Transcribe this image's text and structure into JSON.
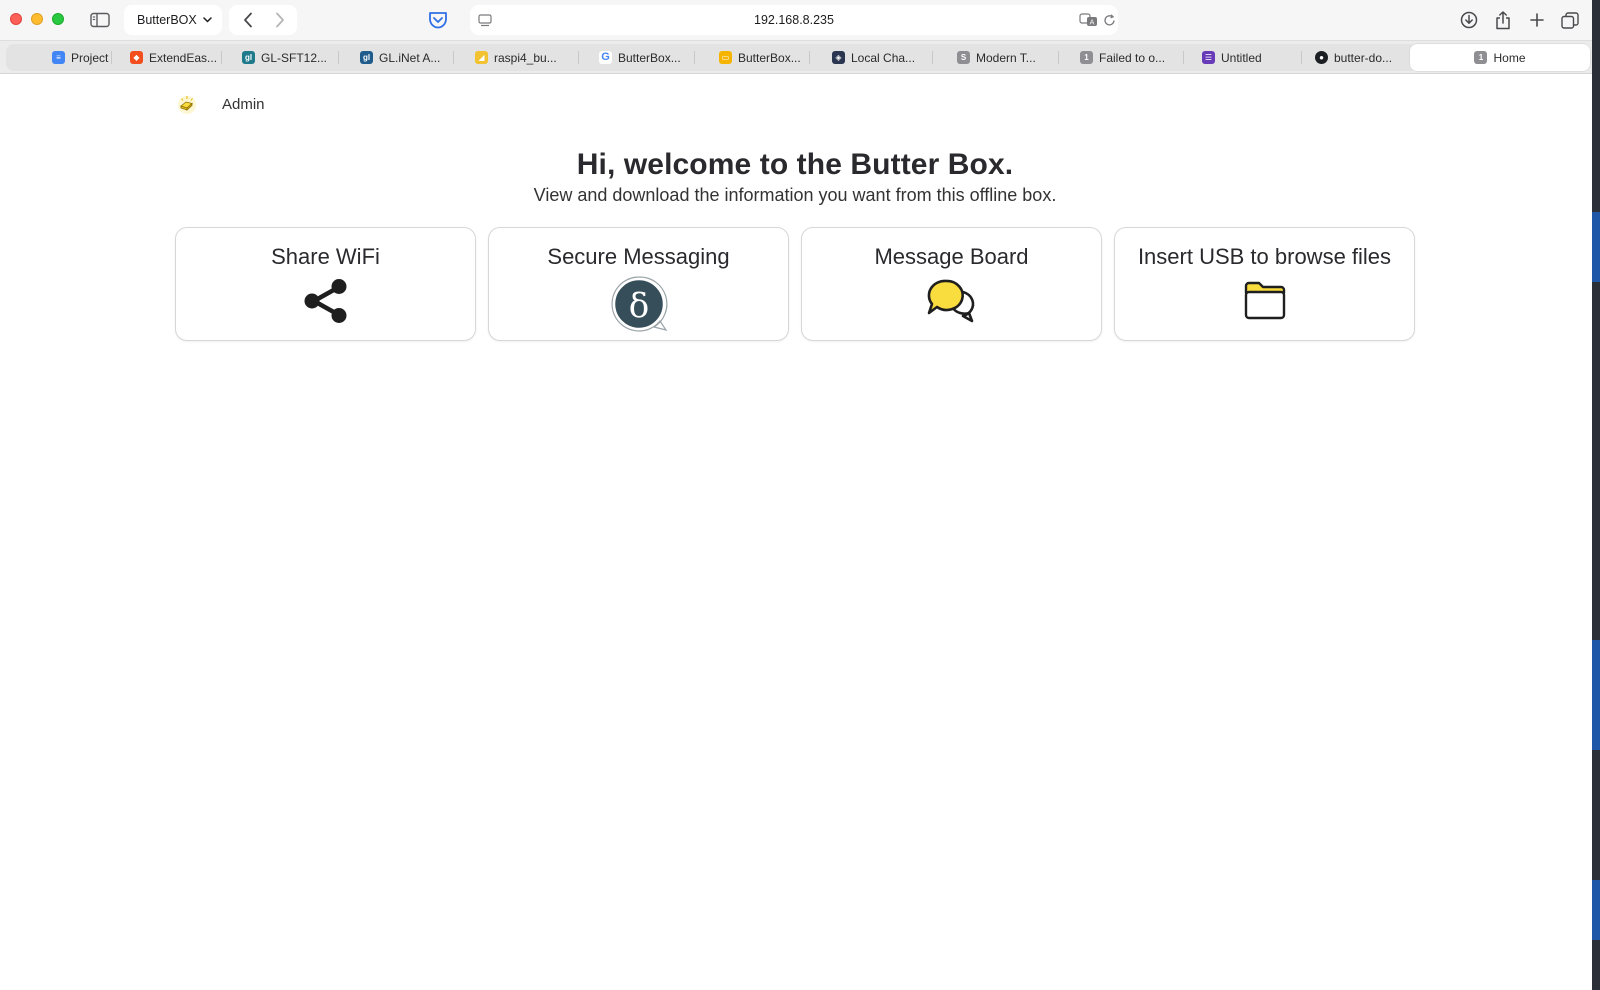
{
  "browser": {
    "tab_group": "ButterBOX",
    "address": "192.168.8.235"
  },
  "tabs": [
    {
      "label": "Project",
      "icon": "docs-icon",
      "color": "#4285f4"
    },
    {
      "label": "ExtendEas...",
      "icon": "figma-icon",
      "color": "#f24e1e"
    },
    {
      "label": "GL-SFT12...",
      "icon": "glinet-icon",
      "color": "#1f7a8c"
    },
    {
      "label": "GL.iNet A...",
      "icon": "glinet-icon",
      "color": "#1f5c8c"
    },
    {
      "label": "raspi4_bu...",
      "icon": "butter-icon",
      "color": "#f2c230"
    },
    {
      "label": "ButterBox...",
      "icon": "google-icon",
      "color": "#ffffff"
    },
    {
      "label": "ButterBox...",
      "icon": "slides-icon",
      "color": "#f4b400"
    },
    {
      "label": "Local Cha...",
      "icon": "app-icon",
      "color": "#2a3550"
    },
    {
      "label": "Modern T...",
      "icon": "s-icon",
      "color": "#8e8e93"
    },
    {
      "label": "Failed to o...",
      "icon": "number-1-icon",
      "color": "#8e8e93"
    },
    {
      "label": "Untitled",
      "icon": "forms-icon",
      "color": "#673ab7"
    },
    {
      "label": "butter-do...",
      "icon": "github-icon",
      "color": "#1b1f23"
    },
    {
      "label": "Home",
      "icon": "number-1-icon",
      "color": "#8e8e93"
    }
  ],
  "page": {
    "admin_label": "Admin",
    "title": "Hi, welcome to the Butter Box.",
    "subtitle": "View and download the information you want from this offline box.",
    "cards": [
      {
        "title": "Share WiFi",
        "icon": "share-icon"
      },
      {
        "title": "Secure Messaging",
        "icon": "delta-chat-icon"
      },
      {
        "title": "Message Board",
        "icon": "chat-bubbles-icon"
      },
      {
        "title": "Insert USB to browse files",
        "icon": "folder-icon"
      }
    ]
  },
  "colors": {
    "butter_yellow": "#f9dc3e",
    "delta_dark": "#364e59"
  }
}
